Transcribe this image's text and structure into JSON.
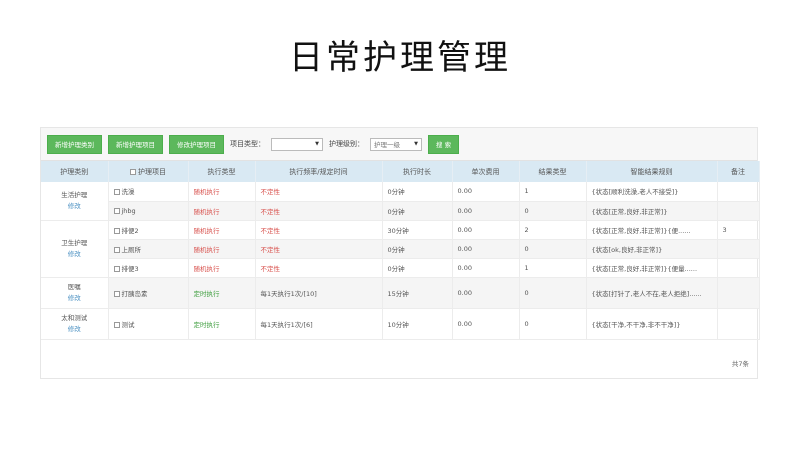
{
  "title": "日常护理管理",
  "toolbar": {
    "btn_new_category": "新增护理类别",
    "btn_new_item": "新增护理项目",
    "btn_edit_item": "修改护理项目",
    "type_label": "项目类型：",
    "type_value": "",
    "level_label": "护理级别：",
    "level_value": "护理一级",
    "search": "搜 索"
  },
  "columns": [
    "护理类别",
    "护理项目",
    "执行类型",
    "执行频率/规定时间",
    "执行时长",
    "单次费用",
    "结果类型",
    "智能结果规则",
    "备注"
  ],
  "groups": [
    {
      "category": "生活护理",
      "edit": "修改"
    },
    {
      "category": "卫生护理",
      "edit": "修改"
    },
    {
      "category": "医嘱",
      "edit": "修改"
    },
    {
      "category": "太和测试",
      "edit": "修改"
    }
  ],
  "rows": [
    {
      "item": "洗澡",
      "exec_type": "随机执行",
      "freq": "不定性",
      "duration": "0分钟",
      "fee": "0.00",
      "result_type": "1",
      "rule": "{状态[顺利洗澡,老人不接受]}",
      "note": ""
    },
    {
      "item": "jhbg",
      "exec_type": "随机执行",
      "freq": "不定性",
      "duration": "0分钟",
      "fee": "0.00",
      "result_type": "0",
      "rule": "{状态[正常,良好,非正常]}",
      "note": ""
    },
    {
      "item": "排便2",
      "exec_type": "随机执行",
      "freq": "不定性",
      "duration": "30分钟",
      "fee": "0.00",
      "result_type": "2",
      "rule": "{状态[正常,良好,非正常]}{便......",
      "note": "3"
    },
    {
      "item": "上厕所",
      "exec_type": "随机执行",
      "freq": "不定性",
      "duration": "0分钟",
      "fee": "0.00",
      "result_type": "0",
      "rule": "{状态[ok,良好,非正常]}",
      "note": ""
    },
    {
      "item": "排便3",
      "exec_type": "随机执行",
      "freq": "不定性",
      "duration": "0分钟",
      "fee": "0.00",
      "result_type": "1",
      "rule": "{状态[正常,良好,非正常]}{便量......",
      "note": ""
    },
    {
      "item": "打胰岛素",
      "exec_type": "定时执行",
      "freq": "每1天执行1次/[10]",
      "duration": "15分钟",
      "fee": "0.00",
      "result_type": "0",
      "rule": "{状态[打针了,老人不在,老人拒绝]......",
      "note": ""
    },
    {
      "item": "测试",
      "exec_type": "定时执行",
      "freq": "每1天执行1次/[6]",
      "duration": "10分钟",
      "fee": "0.00",
      "result_type": "0",
      "rule": "{状态[干净,不干净,非不干净]}",
      "note": ""
    }
  ],
  "total": "共7条",
  "colors": {
    "button": "#5cb85c",
    "header": "#d9e9f3",
    "link": "#4a90c2",
    "random": "#d9534f",
    "timed": "#3c9d3c"
  }
}
